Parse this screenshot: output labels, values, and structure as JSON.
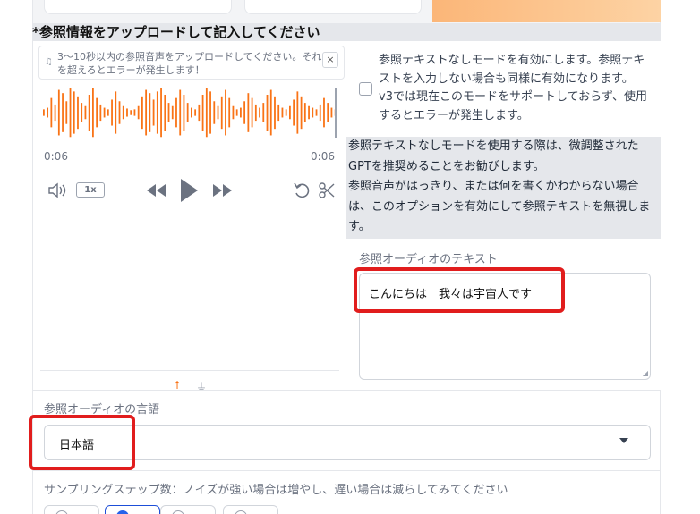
{
  "section": {
    "title": "*参照情報をアップロードして記入してください"
  },
  "audio": {
    "hint": "3〜10秒以内の参照音声をアップロードしてください。それを超えるとエラーが発生します！",
    "close_symbol": "×",
    "time_current": "0:06",
    "time_total": "0:06",
    "speed": "1x",
    "accent_color": "#f97316"
  },
  "no_ref_mode": {
    "checked": false,
    "label": "参照テキストなしモードを有効にします。参照テキストを入力しない場合も同様に有効になります。v3では現在このモードをサポートしておらず、使用するとエラーが発生します。"
  },
  "info": {
    "line1": "参照テキストなしモードを使用する際は、微調整されたGPTを推奨めることをお勧びします。",
    "line2": "参照音声がはっきり、または何を書くかわからない場合は、このオプションを有効にして参照テキストを無視します。"
  },
  "ref_text": {
    "label": "参照オーディオのテキスト",
    "value": "こんにちは　我々は宇宙人です"
  },
  "language": {
    "label": "参照オーディオの言語",
    "selected": "日本語"
  },
  "steps": {
    "label": "サンプリングステップ数：ノイズが強い場合は増やし、遅い場合は減らしてみてください"
  },
  "icons": [
    "music-note-icon",
    "volume-icon",
    "rewind-icon",
    "play-icon",
    "fast-forward-icon",
    "undo-icon",
    "scissors-icon",
    "upload-icon",
    "microphone-icon",
    "close-icon",
    "chevron-down-icon"
  ]
}
